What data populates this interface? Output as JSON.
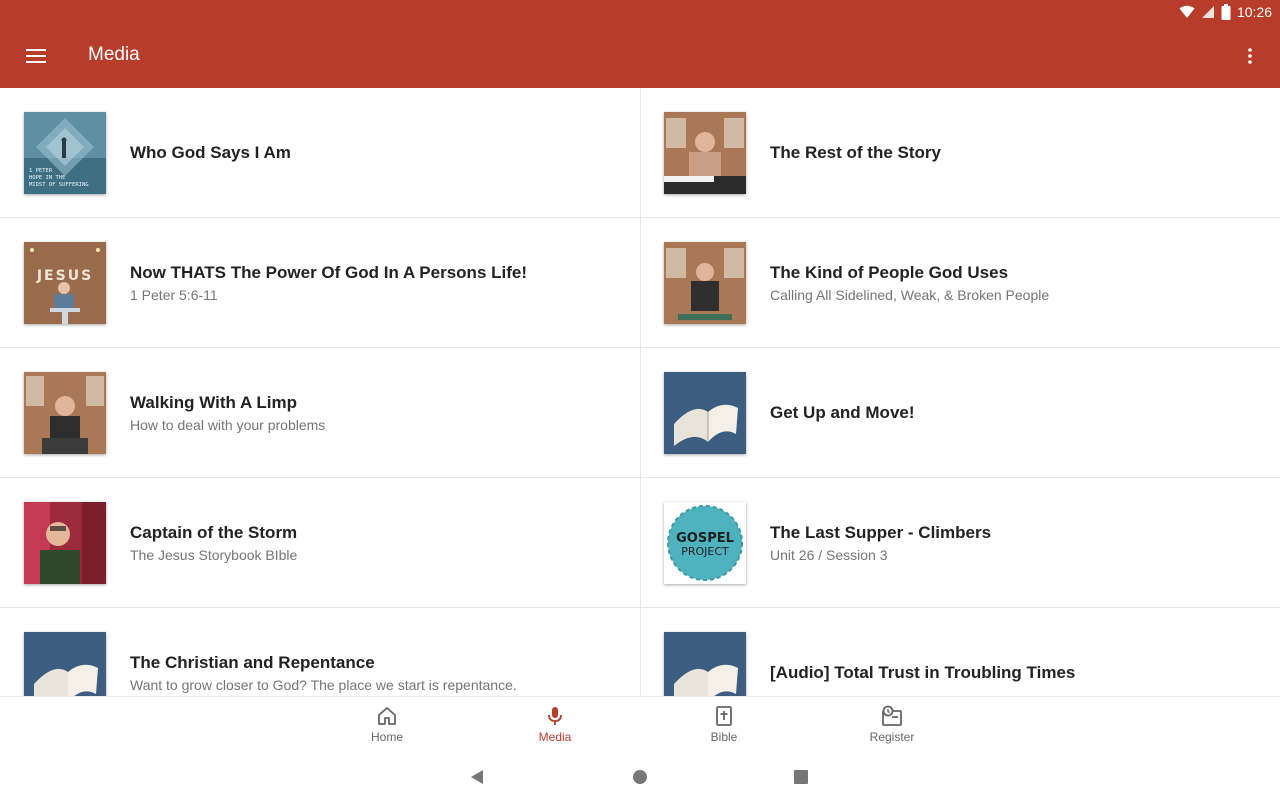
{
  "status_bar": {
    "time": "10:26",
    "icons": [
      "wifi-icon",
      "cell-signal-icon",
      "battery-icon"
    ]
  },
  "app_bar": {
    "title": "Media",
    "left_icon": "menu-icon",
    "right_icon": "more-vert-icon",
    "color": "#b73c2a"
  },
  "media": [
    {
      "title": "Who God Says I Am",
      "subtitle": "",
      "thumb": "1-peter-series-art",
      "thumb_text": [
        "1 PETER",
        "HOPE IN THE",
        "MIDST OF SUFFERING"
      ]
    },
    {
      "title": "The Rest of the Story",
      "subtitle": "",
      "thumb": "jesus-series-speaker-1"
    },
    {
      "title": "Now THATS The Power Of God In A Persons Life!",
      "subtitle": "1 Peter 5:6-11",
      "thumb": "jesus-series-speaker-2",
      "thumb_text": [
        "JESUS"
      ]
    },
    {
      "title": "The Kind of People God Uses",
      "subtitle": "Calling All Sidelined, Weak, & Broken People",
      "thumb": "jesus-series-speaker-3"
    },
    {
      "title": "Walking With A Limp",
      "subtitle": "How to deal with your problems",
      "thumb": "jesus-series-speaker-4"
    },
    {
      "title": "Get Up and Move!",
      "subtitle": "",
      "thumb": "open-bible-photo"
    },
    {
      "title": "Captain of the Storm",
      "subtitle": "The Jesus Storybook BIble",
      "thumb": "teacher-photo"
    },
    {
      "title": "The Last Supper - Climbers",
      "subtitle": "Unit 26 / Session 3",
      "thumb": "gospel-project-logo",
      "thumb_text": [
        "GOSPEL",
        "PROJECT"
      ]
    },
    {
      "title": "The Christian and Repentance",
      "subtitle": "Want to grow closer to God? The place we start is repentance.",
      "thumb": "open-bible-photo"
    },
    {
      "title": "[Audio] Total Trust in Troubling Times",
      "subtitle": "",
      "thumb": "open-bible-photo"
    }
  ],
  "bottom_nav": [
    {
      "label": "Home",
      "icon": "home-icon",
      "active": false
    },
    {
      "label": "Media",
      "icon": "microphone-icon",
      "active": true
    },
    {
      "label": "Bible",
      "icon": "bible-icon",
      "active": false
    },
    {
      "label": "Register",
      "icon": "register-icon",
      "active": false
    }
  ],
  "system_nav": [
    "back-icon",
    "home-circle-icon",
    "recents-icon"
  ],
  "colors": {
    "accent": "#b73c2a",
    "divider": "#e6e6e6",
    "subtitle": "#757575"
  }
}
